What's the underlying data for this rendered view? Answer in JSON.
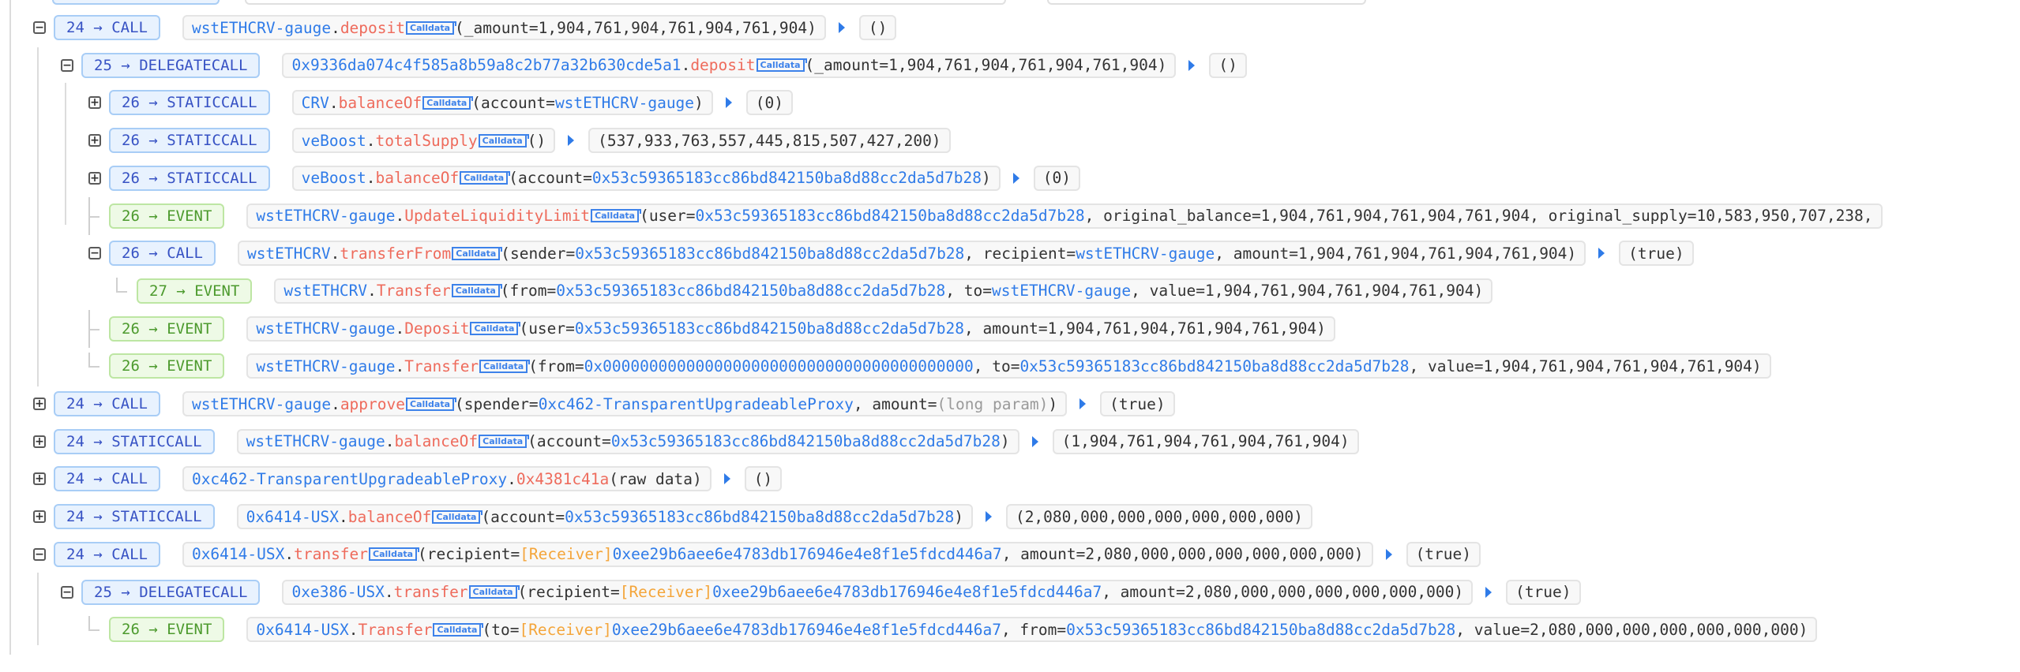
{
  "colors": {
    "call_badge_bg": "#e8f2fe",
    "call_badge_text": "#3752c4",
    "event_badge_bg": "#eefae6",
    "event_badge_text": "#4c9a2d",
    "address": "#2f7be8",
    "method": "#ee6b5c",
    "receiver_tag": "#f4a53a"
  },
  "calldata_label": "Calldata",
  "rows": [
    {
      "depth": 0,
      "toggle": "collapse",
      "badge": "24 → CALL",
      "type": "call",
      "parts": [
        [
          "blue",
          "wstETHCRV-gauge"
        ],
        [
          "plain",
          "."
        ],
        [
          "red",
          "deposit"
        ],
        [
          "calldata",
          ""
        ],
        [
          "plain",
          "(_amount=1,904,761,904,761,904,761,904)"
        ]
      ],
      "ret": "()"
    },
    {
      "depth": 1,
      "toggle": "collapse",
      "badge": "25 → DELEGATECALL",
      "type": "call",
      "parts": [
        [
          "blue",
          "0x9336da074c4f585a8b59a8c2b77a32b630cde5a1"
        ],
        [
          "plain",
          "."
        ],
        [
          "red",
          "deposit"
        ],
        [
          "calldata",
          ""
        ],
        [
          "plain",
          "(_amount=1,904,761,904,761,904,761,904)"
        ]
      ],
      "ret": "()"
    },
    {
      "depth": 2,
      "toggle": "expand",
      "badge": "26 → STATICCALL",
      "type": "call",
      "parts": [
        [
          "blue",
          "CRV"
        ],
        [
          "plain",
          "."
        ],
        [
          "red",
          "balanceOf"
        ],
        [
          "calldata",
          ""
        ],
        [
          "plain",
          "(account="
        ],
        [
          "blue",
          "wstETHCRV-gauge"
        ],
        [
          "plain",
          ")"
        ]
      ],
      "ret": "(0)"
    },
    {
      "depth": 2,
      "toggle": "expand",
      "badge": "26 → STATICCALL",
      "type": "call",
      "parts": [
        [
          "blue",
          "veBoost"
        ],
        [
          "plain",
          "."
        ],
        [
          "red",
          "totalSupply"
        ],
        [
          "calldata",
          ""
        ],
        [
          "plain",
          "()"
        ]
      ],
      "ret": "(537,933,763,557,445,815,507,427,200)"
    },
    {
      "depth": 2,
      "toggle": "expand",
      "badge": "26 → STATICCALL",
      "type": "call",
      "parts": [
        [
          "blue",
          "veBoost"
        ],
        [
          "plain",
          "."
        ],
        [
          "red",
          "balanceOf"
        ],
        [
          "calldata",
          ""
        ],
        [
          "plain",
          "(account="
        ],
        [
          "blue",
          "0x53c59365183cc86bd842150ba8d88cc2da5d7b28"
        ],
        [
          "plain",
          ")"
        ]
      ],
      "ret": "(0)"
    },
    {
      "depth": 2,
      "toggle": "branch-mid",
      "badge": "26 → EVENT",
      "type": "event",
      "parts": [
        [
          "blue",
          "wstETHCRV-gauge"
        ],
        [
          "plain",
          "."
        ],
        [
          "red",
          "UpdateLiquidityLimit"
        ],
        [
          "calldata",
          ""
        ],
        [
          "plain",
          "(user="
        ],
        [
          "blue",
          "0x53c59365183cc86bd842150ba8d88cc2da5d7b28"
        ],
        [
          "plain",
          ", original_balance=1,904,761,904,761,904,761,904, original_supply=10,583,950,707,238,"
        ]
      ],
      "ret": null
    },
    {
      "depth": 2,
      "toggle": "collapse",
      "badge": "26 → CALL",
      "type": "call",
      "parts": [
        [
          "blue",
          "wstETHCRV"
        ],
        [
          "plain",
          "."
        ],
        [
          "red",
          "transferFrom"
        ],
        [
          "calldata",
          ""
        ],
        [
          "plain",
          "(sender="
        ],
        [
          "blue",
          "0x53c59365183cc86bd842150ba8d88cc2da5d7b28"
        ],
        [
          "plain",
          ", recipient="
        ],
        [
          "blue",
          "wstETHCRV-gauge"
        ],
        [
          "plain",
          ", amount=1,904,761,904,761,904,761,904)"
        ]
      ],
      "ret": "(true)"
    },
    {
      "depth": 3,
      "toggle": "branch-end",
      "badge": "27 → EVENT",
      "type": "event",
      "parts": [
        [
          "blue",
          "wstETHCRV"
        ],
        [
          "plain",
          "."
        ],
        [
          "red",
          "Transfer"
        ],
        [
          "calldata",
          ""
        ],
        [
          "plain",
          "(from="
        ],
        [
          "blue",
          "0x53c59365183cc86bd842150ba8d88cc2da5d7b28"
        ],
        [
          "plain",
          ", to="
        ],
        [
          "blue",
          "wstETHCRV-gauge"
        ],
        [
          "plain",
          ", value=1,904,761,904,761,904,761,904)"
        ]
      ],
      "ret": null
    },
    {
      "depth": 2,
      "toggle": "branch-mid",
      "badge": "26 → EVENT",
      "type": "event",
      "parts": [
        [
          "blue",
          "wstETHCRV-gauge"
        ],
        [
          "plain",
          "."
        ],
        [
          "red",
          "Deposit"
        ],
        [
          "calldata",
          ""
        ],
        [
          "plain",
          "(user="
        ],
        [
          "blue",
          "0x53c59365183cc86bd842150ba8d88cc2da5d7b28"
        ],
        [
          "plain",
          ", amount=1,904,761,904,761,904,761,904)"
        ]
      ],
      "ret": null
    },
    {
      "depth": 2,
      "toggle": "branch-end",
      "badge": "26 → EVENT",
      "type": "event",
      "parts": [
        [
          "blue",
          "wstETHCRV-gauge"
        ],
        [
          "plain",
          "."
        ],
        [
          "red",
          "Transfer"
        ],
        [
          "calldata",
          ""
        ],
        [
          "plain",
          "(from="
        ],
        [
          "blue",
          "0x0000000000000000000000000000000000000000"
        ],
        [
          "plain",
          ", to="
        ],
        [
          "blue",
          "0x53c59365183cc86bd842150ba8d88cc2da5d7b28"
        ],
        [
          "plain",
          ", value=1,904,761,904,761,904,761,904)"
        ]
      ],
      "ret": null
    },
    {
      "depth": 0,
      "toggle": "expand",
      "badge": "24 → CALL",
      "type": "call",
      "parts": [
        [
          "blue",
          "wstETHCRV-gauge"
        ],
        [
          "plain",
          "."
        ],
        [
          "red",
          "approve"
        ],
        [
          "calldata",
          ""
        ],
        [
          "plain",
          "(spender="
        ],
        [
          "blue",
          "0xc462-TransparentUpgradeableProxy"
        ],
        [
          "plain",
          ", amount="
        ],
        [
          "grey",
          "(long param)"
        ],
        [
          "plain",
          ")"
        ]
      ],
      "ret": "(true)"
    },
    {
      "depth": 0,
      "toggle": "expand",
      "badge": "24 → STATICCALL",
      "type": "call",
      "parts": [
        [
          "blue",
          "wstETHCRV-gauge"
        ],
        [
          "plain",
          "."
        ],
        [
          "red",
          "balanceOf"
        ],
        [
          "calldata",
          ""
        ],
        [
          "plain",
          "(account="
        ],
        [
          "blue",
          "0x53c59365183cc86bd842150ba8d88cc2da5d7b28"
        ],
        [
          "plain",
          ")"
        ]
      ],
      "ret": "(1,904,761,904,761,904,761,904)"
    },
    {
      "depth": 0,
      "toggle": "expand",
      "badge": "24 → CALL",
      "type": "call",
      "parts": [
        [
          "blue",
          "0xc462-TransparentUpgradeableProxy"
        ],
        [
          "plain",
          "."
        ],
        [
          "red",
          "0x4381c41a"
        ],
        [
          "plain",
          "(raw data)"
        ]
      ],
      "ret": "()"
    },
    {
      "depth": 0,
      "toggle": "expand",
      "badge": "24 → STATICCALL",
      "type": "call",
      "parts": [
        [
          "blue",
          "0x6414-USX"
        ],
        [
          "plain",
          "."
        ],
        [
          "red",
          "balanceOf"
        ],
        [
          "calldata",
          ""
        ],
        [
          "plain",
          "(account="
        ],
        [
          "blue",
          "0x53c59365183cc86bd842150ba8d88cc2da5d7b28"
        ],
        [
          "plain",
          ")"
        ]
      ],
      "ret": "(2,080,000,000,000,000,000,000)"
    },
    {
      "depth": 0,
      "toggle": "collapse",
      "badge": "24 → CALL",
      "type": "call",
      "parts": [
        [
          "blue",
          "0x6414-USX"
        ],
        [
          "plain",
          "."
        ],
        [
          "red",
          "transfer"
        ],
        [
          "calldata",
          ""
        ],
        [
          "plain",
          "(recipient="
        ],
        [
          "orange",
          "[Receiver]"
        ],
        [
          "blue",
          "0xee29b6aee6e4783db176946e4e8f1e5fdcd446a7"
        ],
        [
          "plain",
          ", amount=2,080,000,000,000,000,000,000)"
        ]
      ],
      "ret": "(true)"
    },
    {
      "depth": 1,
      "toggle": "collapse",
      "badge": "25 → DELEGATECALL",
      "type": "call",
      "parts": [
        [
          "blue",
          "0xe386-USX"
        ],
        [
          "plain",
          "."
        ],
        [
          "red",
          "transfer"
        ],
        [
          "calldata",
          ""
        ],
        [
          "plain",
          "(recipient="
        ],
        [
          "orange",
          "[Receiver]"
        ],
        [
          "blue",
          "0xee29b6aee6e4783db176946e4e8f1e5fdcd446a7"
        ],
        [
          "plain",
          ", amount=2,080,000,000,000,000,000,000)"
        ]
      ],
      "ret": "(true)"
    },
    {
      "depth": 2,
      "toggle": "branch-end",
      "badge": "26 → EVENT",
      "type": "event",
      "parts": [
        [
          "blue",
          "0x6414-USX"
        ],
        [
          "plain",
          "."
        ],
        [
          "red",
          "Transfer"
        ],
        [
          "calldata",
          ""
        ],
        [
          "plain",
          "(to="
        ],
        [
          "orange",
          "[Receiver]"
        ],
        [
          "blue",
          "0xee29b6aee6e4783db176946e4e8f1e5fdcd446a7"
        ],
        [
          "plain",
          ", from="
        ],
        [
          "blue",
          "0x53c59365183cc86bd842150ba8d88cc2da5d7b28"
        ],
        [
          "plain",
          ", value=2,080,000,000,000,000,000,000)"
        ]
      ],
      "ret": null
    }
  ]
}
